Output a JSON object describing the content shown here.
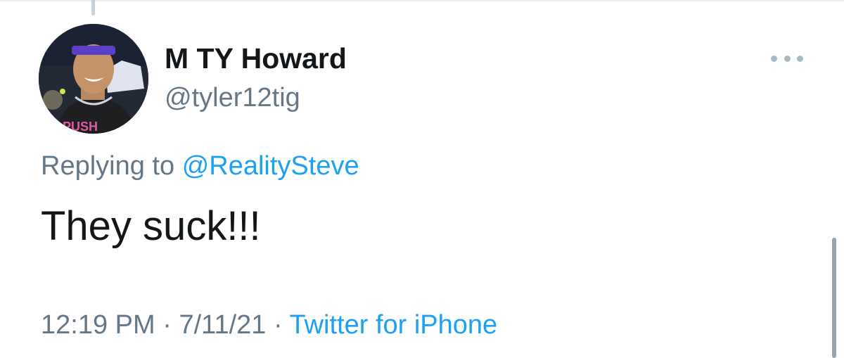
{
  "tweet": {
    "author": {
      "display_name": "M TY Howard",
      "handle": "@tyler12tig",
      "avatar_shirt_text": "PUSH"
    },
    "replying_prefix": "Replying to",
    "replying_mention": "@RealitySteve",
    "text": "They suck!!!",
    "time": "12:19 PM",
    "separator": "·",
    "date": "7/11/21",
    "source": "Twitter for iPhone"
  },
  "icons": {
    "more": "more-horizontal-icon"
  },
  "colors": {
    "link": "#1da1f2",
    "secondary_text": "#657786",
    "primary_text": "#14171a"
  }
}
